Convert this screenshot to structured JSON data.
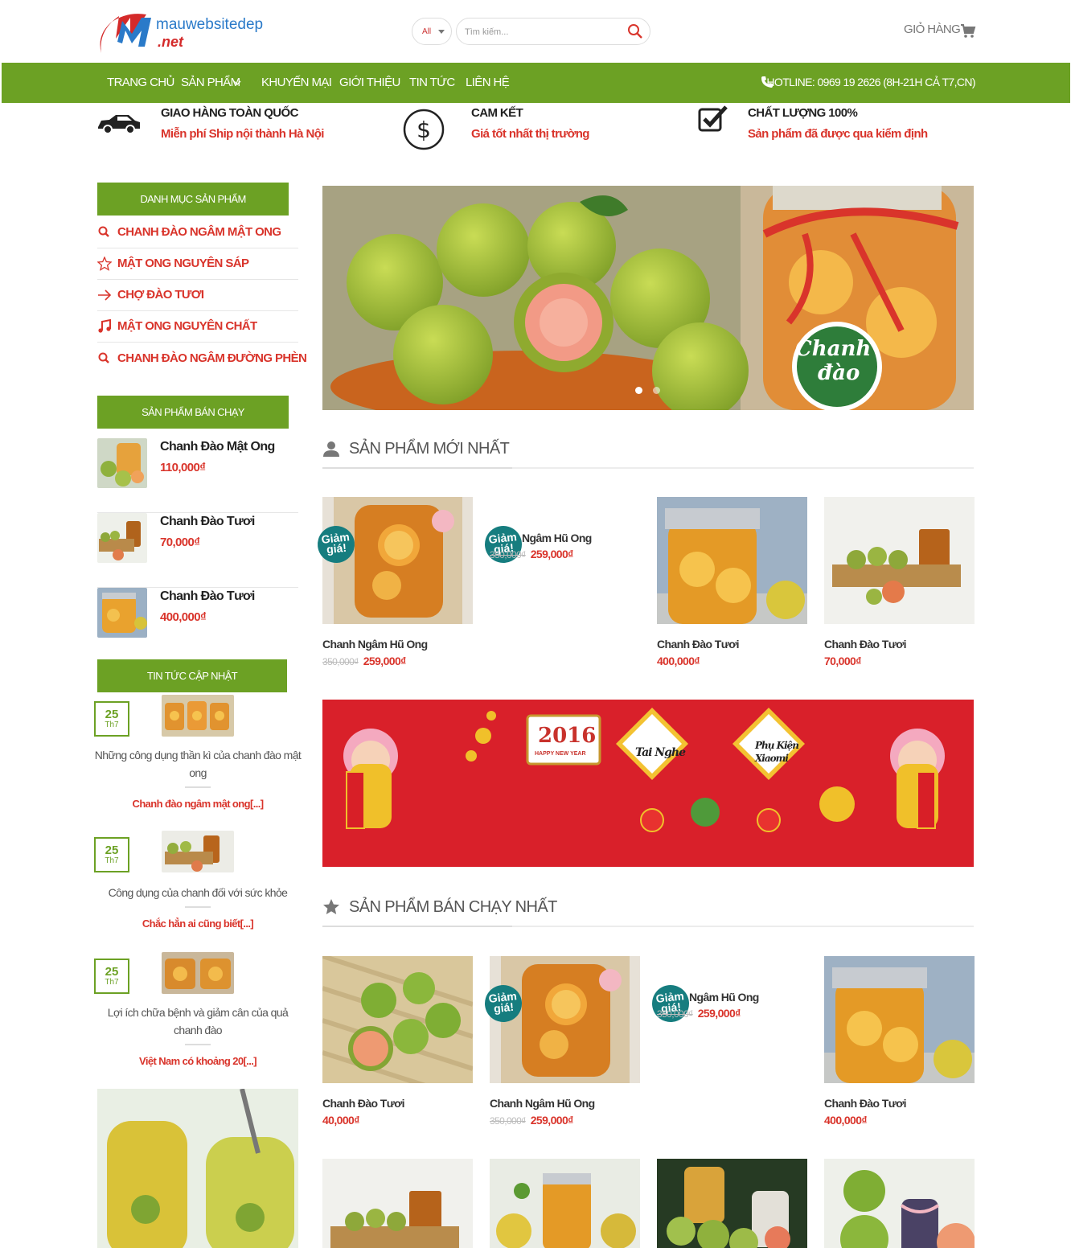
{
  "header": {
    "logo_main": "mauwebsitedep",
    "logo_sub": ".net",
    "search_category": "All",
    "search_placeholder": "Tìm kiếm...",
    "cart_label": "GIỎ HÀNG"
  },
  "nav": {
    "items": [
      "TRANG CHỦ",
      "SẢN PHẨM",
      "KHUYẾN MẠI",
      "GIỚI THIỆU",
      "TIN TỨC",
      "LIÊN HỆ"
    ],
    "hotline": "HOTLINE: 0969 19 2626 (8H-21H CẢ T7,CN)"
  },
  "features": [
    {
      "title": "GIAO HÀNG TOÀN QUỐC",
      "subtitle": "Miễn phí Ship nội thành Hà Nội",
      "icon": "car-icon"
    },
    {
      "title": "CAM KẾT",
      "subtitle": "Giá tốt nhất thị trường",
      "icon": "dollar-icon"
    },
    {
      "title": "CHẤT LƯỢNG 100%",
      "subtitle": "Sản phẩm đã được qua kiểm định",
      "icon": "checkbox-icon"
    }
  ],
  "sidebar": {
    "categories_title": "DANH MỤC SẢN PHẨM",
    "categories": [
      {
        "label": "CHANH ĐÀO NGÂM MẬT ONG",
        "icon": "search-icon"
      },
      {
        "label": "MẬT ONG NGUYÊN SÁP",
        "icon": "star-icon"
      },
      {
        "label": "CHỢ ĐÀO TƯƠI",
        "icon": "arrow-right-icon"
      },
      {
        "label": "MẬT ONG NGUYÊN CHẤT",
        "icon": "music-icon"
      },
      {
        "label": "CHANH ĐÀO NGÂM ĐƯỜNG PHÈN",
        "icon": "search-icon"
      }
    ],
    "bestsellers_title": "SẢN PHẨM BÁN CHẠY",
    "bestsellers": [
      {
        "name": "Chanh Đào Mật Ong",
        "price": "110,000₫"
      },
      {
        "name": "Chanh Đào Tươi",
        "price": "70,000₫"
      },
      {
        "name": "Chanh Đào Tươi",
        "price": "400,000₫"
      }
    ],
    "news_title": "TIN TỨC CẬP NHẬT",
    "news": [
      {
        "day": "25",
        "month": "Th7",
        "title": "Những công dụng thần kì của chanh đào mật ong",
        "excerpt": "Chanh đào ngâm mật ong[...]"
      },
      {
        "day": "25",
        "month": "Th7",
        "title": "Công dụng của chanh đối với sức khỏe",
        "excerpt": "Chắc hẳn ai cũng biết[...]"
      },
      {
        "day": "25",
        "month": "Th7",
        "title": "Lợi ích chữa bệnh và giảm cân của quả chanh đào",
        "excerpt": "Việt Nam có khoảng 20[...]"
      }
    ]
  },
  "hero": {
    "logo_line1": "Chanh",
    "logo_line2": "đào"
  },
  "sections": {
    "new_title": "SẢN PHẨM MỚI NHẤT",
    "bestselling_title": "SẢN PHẨM BÁN CHẠY NHẤT"
  },
  "badge_text": "Giảm giá!",
  "new_products": [
    {
      "name": "Chanh Ngâm Hũ Ong",
      "old_price": "350,000₫",
      "price": "259,000₫",
      "sale": true
    },
    {
      "name": "Ngâm Hũ Ong",
      "old_price": "350,000₫",
      "price": "259,000₫",
      "sale": true
    },
    {
      "name": "Chanh Đào Tươi",
      "old_price": "",
      "price": "400,000₫",
      "sale": false
    },
    {
      "name": "Chanh Đào Tươi",
      "old_price": "",
      "price": "70,000₫",
      "sale": false
    }
  ],
  "best_products": [
    {
      "name": "Chanh Đào Tươi",
      "old_price": "",
      "price": "40,000₫",
      "sale": false
    },
    {
      "name": "Chanh Ngâm Hũ Ong",
      "old_price": "350,000₫",
      "price": "259,000₫",
      "sale": true
    },
    {
      "name": "Ngâm Hũ Ong",
      "old_price": "350,000₫",
      "price": "259,000₫",
      "sale": true
    },
    {
      "name": "Chanh Đào Tươi",
      "old_price": "",
      "price": "400,000₫",
      "sale": false
    }
  ],
  "promo": {
    "new_year": "2016",
    "happy": "HAPPY NEW YEAR",
    "tag1": "Tai Nghe",
    "tag2_line1": "Phụ Kiện",
    "tag2_line2": "Xiaomi"
  },
  "colors": {
    "brand_green": "#6ca124",
    "accent_red": "#d9342b",
    "badge_teal": "#167d7f",
    "promo_red": "#d9202a"
  }
}
